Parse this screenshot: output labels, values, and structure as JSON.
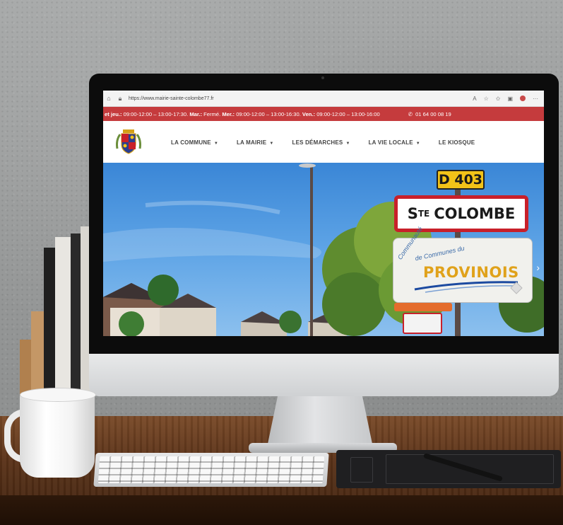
{
  "browser": {
    "url": "https://www.mairie-sainte-colombe77.fr"
  },
  "info_bar": {
    "hours_parts": [
      {
        "label": "et jeu.:",
        "text": " 09:00-12:00 – 13:00-17:30. "
      },
      {
        "label": "Mar.:",
        "text": " Fermé. "
      },
      {
        "label": "Mer.:",
        "text": " 09:00-12:00 – 13:00-16:30. "
      },
      {
        "label": "Ven.:",
        "text": " 09:00-12:00 – 13:00-16:00"
      }
    ],
    "phone": "01 64 00 08 19"
  },
  "nav": {
    "items": [
      {
        "label": "LA COMMUNE",
        "has_dropdown": true
      },
      {
        "label": "LA MAIRIE",
        "has_dropdown": true
      },
      {
        "label": "LES DÉMARCHES",
        "has_dropdown": true
      },
      {
        "label": "LA VIE LOCALE",
        "has_dropdown": true
      },
      {
        "label": "LE KIOSQUE",
        "has_dropdown": false
      }
    ]
  },
  "hero": {
    "road_sign": "D 403",
    "town_sign": "STE COLOMBE",
    "town_sign_prefix": "S",
    "town_sign_superscript": "TE",
    "town_sign_name": "COLOMBE",
    "cc_sign_line1": "Communauté",
    "cc_sign_line2": "de Communes du",
    "cc_sign_brand": "PROVINOIS"
  },
  "colors": {
    "accent_red": "#c53b3d",
    "sky_blue": "#4a94de",
    "sign_yellow": "#f2c318"
  }
}
